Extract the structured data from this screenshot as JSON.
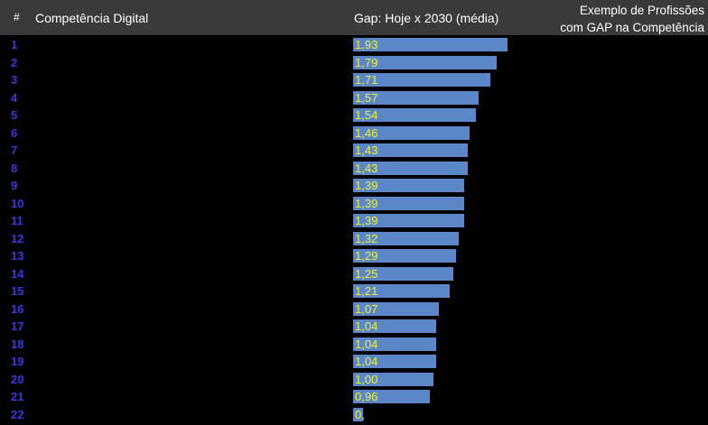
{
  "header": {
    "num_label": "#",
    "competencia_label": "Competência Digital",
    "gap_label": "Gap: Hoje x 2030 (média)",
    "exemplo_line1": "Exemplo de Profissões",
    "exemplo_line2": "com GAP na Competência"
  },
  "colors": {
    "header_bg": "#3a3a3a",
    "row_number": "#3a3adb",
    "bar": "#5b86c7",
    "bar_value": "#eef233"
  },
  "chart_data": {
    "type": "bar",
    "categories": [
      "1",
      "2",
      "3",
      "4",
      "5",
      "6",
      "7",
      "8",
      "9",
      "10",
      "11",
      "12",
      "13",
      "14",
      "15",
      "16",
      "17",
      "18",
      "19",
      "20",
      "21",
      "22"
    ],
    "values": [
      1.93,
      1.79,
      1.71,
      1.57,
      1.54,
      1.46,
      1.43,
      1.43,
      1.39,
      1.39,
      1.39,
      1.32,
      1.29,
      1.25,
      1.21,
      1.07,
      1.04,
      1.04,
      1.04,
      1.0,
      0.96,
      0.12
    ],
    "value_labels": [
      "1,93",
      "1,79",
      "1,71",
      "1,57",
      "1,54",
      "1,46",
      "1,43",
      "1,43",
      "1,39",
      "1,39",
      "1,39",
      "1,32",
      "1,29",
      "1,25",
      "1,21",
      "1,07",
      "1,04",
      "1,04",
      "1,04",
      "1,00",
      "0,96",
      "0,"
    ]
  }
}
